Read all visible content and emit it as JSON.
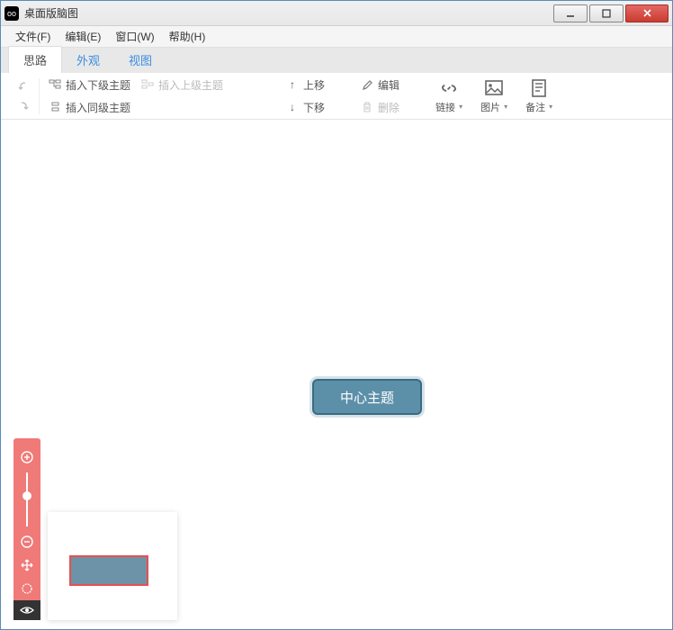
{
  "titlebar": {
    "title": "桌面版脑图"
  },
  "menubar": {
    "file": "文件(F)",
    "edit": "编辑(E)",
    "window": "窗口(W)",
    "help": "帮助(H)"
  },
  "tabs": {
    "thought": "思路",
    "appearance": "外观",
    "view": "视图"
  },
  "ribbon": {
    "insert_child": "插入下级主题",
    "insert_parent": "插入上级主题",
    "insert_sibling": "插入同级主题",
    "move_up": "上移",
    "move_down": "下移",
    "edit": "编辑",
    "delete": "删除",
    "link": "链接",
    "image": "图片",
    "note": "备注"
  },
  "canvas": {
    "central_topic": "中心主题"
  }
}
